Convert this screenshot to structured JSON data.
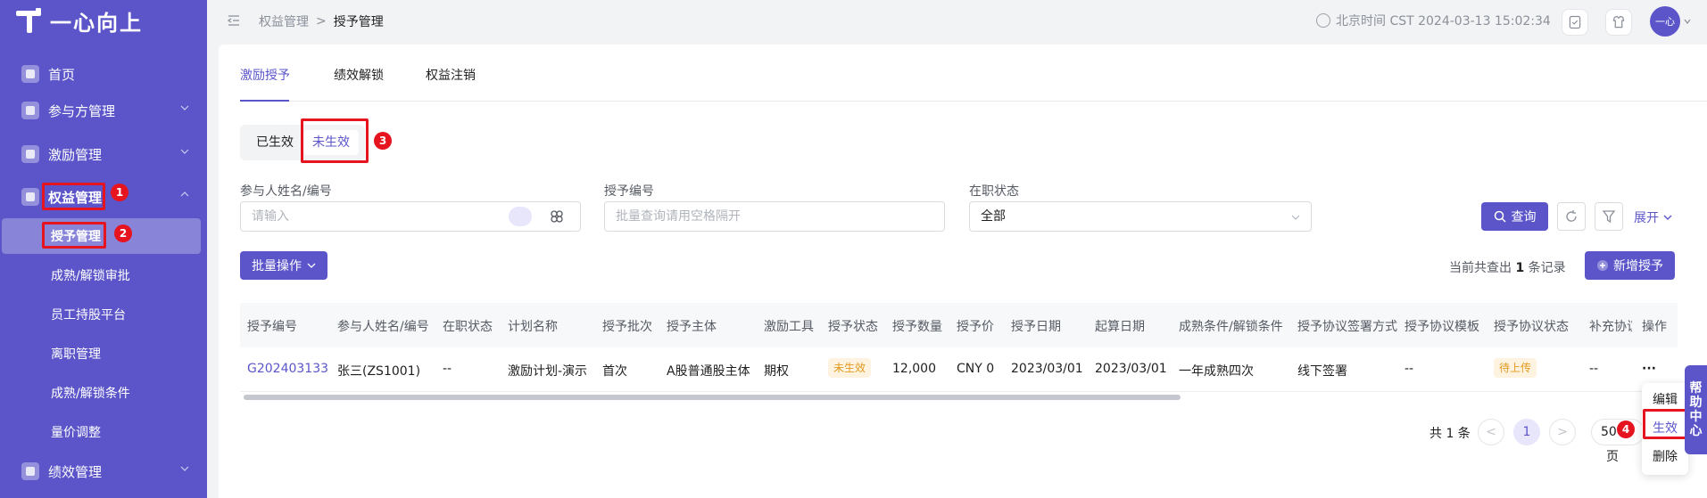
{
  "brand": {
    "name": "一心向上"
  },
  "sidebar": {
    "items": [
      {
        "label": "首页"
      },
      {
        "label": "参与方管理"
      },
      {
        "label": "激励管理"
      },
      {
        "label": "权益管理"
      },
      {
        "label": "授予管理"
      },
      {
        "label": "成熟/解锁审批"
      },
      {
        "label": "员工持股平台"
      },
      {
        "label": "离职管理"
      },
      {
        "label": "成熟/解锁条件"
      },
      {
        "label": "量价调整"
      },
      {
        "label": "绩效管理"
      }
    ]
  },
  "header": {
    "breadcrumb": [
      "权益管理",
      "授予管理"
    ],
    "breadcrumb_sep": ">",
    "clock": "北京时间 CST 2024-03-13 15:02:34",
    "avatar": "一心"
  },
  "tabs": [
    "激励授予",
    "绩效解锁",
    "权益注销"
  ],
  "segments": [
    "已生效",
    "未生效"
  ],
  "filters": {
    "participant_label": "参与人姓名/编号",
    "participant_placeholder": "请输入",
    "grant_no_label": "授予编号",
    "grant_no_placeholder": "批量查询请用空格隔开",
    "employment_label": "在职状态",
    "employment_value": "全部",
    "query_button": "查询",
    "expand_link": "展开"
  },
  "toolbar": {
    "batch_button": "批量操作",
    "records_prefix": "当前共查出",
    "records_count": "1",
    "records_suffix": "条记录",
    "add_button": "新增授予"
  },
  "table": {
    "columns": [
      "授予编号",
      "参与人姓名/编号",
      "在职状态",
      "计划名称",
      "授予批次",
      "授予主体",
      "激励工具",
      "授予状态",
      "授予数量",
      "授予价",
      "授予日期",
      "起算日期",
      "成熟条件/解锁条件",
      "授予协议签署方式",
      "授予协议模板",
      "授予协议状态",
      "补充协议",
      "操作"
    ],
    "rows": [
      {
        "grant_no": "G202403133",
        "participant": "张三(ZS1001)",
        "employment": "--",
        "plan": "激励计划-演示",
        "batch": "首次",
        "entity": "A股普通股主体",
        "tool": "期权",
        "status": "未生效",
        "quantity": "12,000",
        "price": "CNY  0",
        "grant_date": "2023/03/01",
        "start_date": "2023/03/01",
        "condition": "一年成熟四次",
        "sign_method": "线下签署",
        "template": "--",
        "agreement_status": "待上传",
        "supplement": "--",
        "action": "···"
      }
    ]
  },
  "pager": {
    "total": "共 1 条",
    "prev": "<",
    "current": "1",
    "next": ">",
    "size": "50",
    "size_suffix": "页"
  },
  "dropdown": [
    "编辑",
    "生效",
    "删除"
  ],
  "help": [
    "帮",
    "助",
    "中",
    "心"
  ],
  "annotations": [
    "1",
    "2",
    "3",
    "4"
  ],
  "colors": {
    "brand": "#5b55c9",
    "highlight": "#e6141e",
    "warning": "#e39a1c"
  }
}
